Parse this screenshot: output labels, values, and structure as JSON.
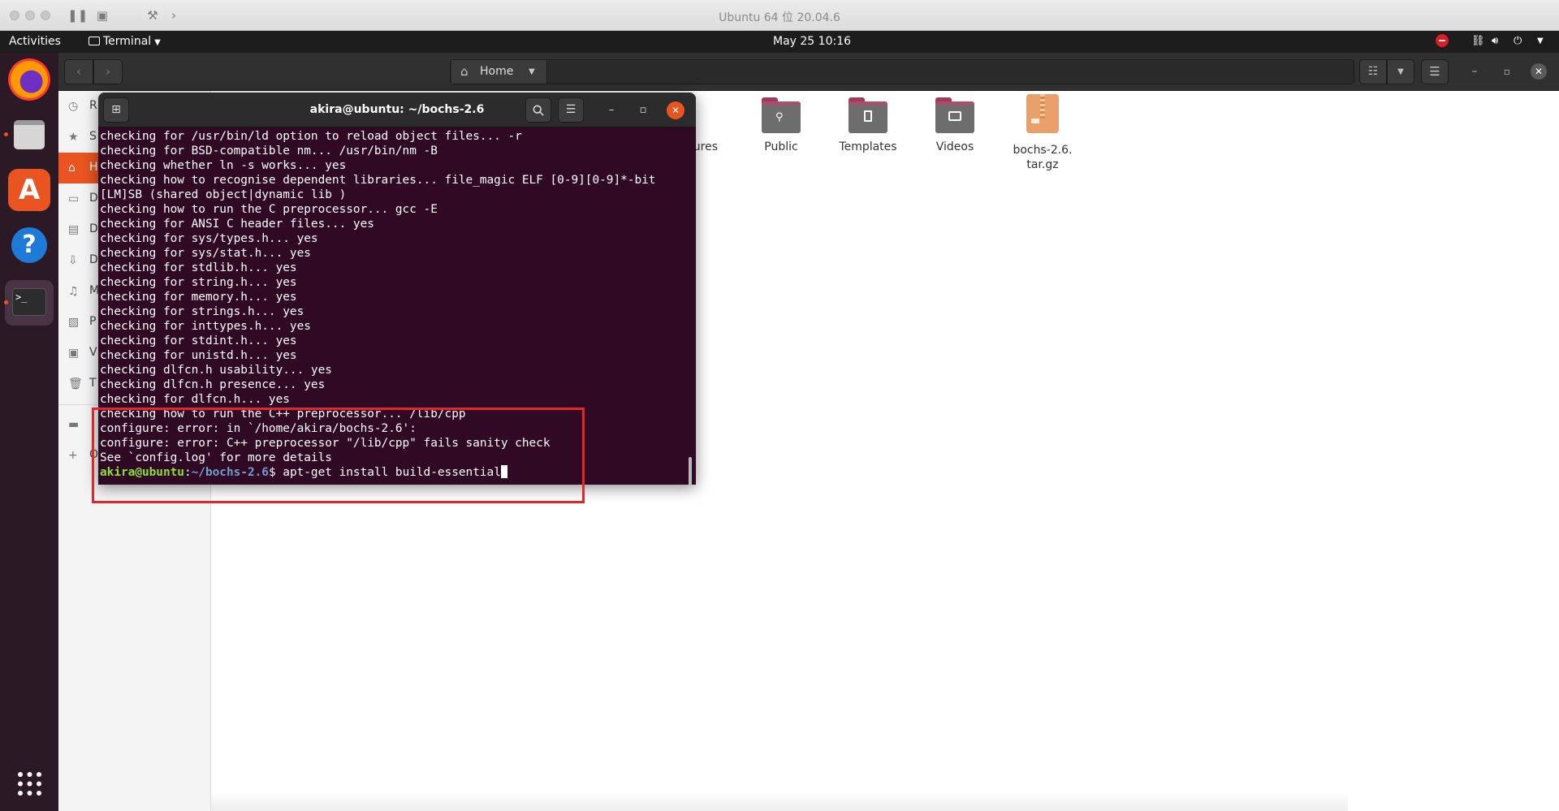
{
  "host": {
    "title": "Ubuntu 64 位 20.04.6"
  },
  "top_panel": {
    "activities": "Activities",
    "app_menu": "Terminal",
    "clock": "May 25  10:16"
  },
  "dock": {
    "apps": [
      {
        "name": "firefox",
        "icon": "firefox-icon"
      },
      {
        "name": "files",
        "icon": "files-icon"
      },
      {
        "name": "ubuntu-software",
        "icon": "software-icon"
      },
      {
        "name": "help",
        "icon": "help-icon"
      },
      {
        "name": "terminal",
        "icon": "terminal-icon"
      }
    ],
    "show_apps_icon": "grid-icon"
  },
  "files": {
    "location": "Home",
    "sidebar": [
      {
        "label": "R",
        "icon": "recent-icon"
      },
      {
        "label": "S",
        "icon": "star-icon"
      },
      {
        "label": "H",
        "icon": "home-icon"
      },
      {
        "label": "D",
        "icon": "desktop-icon"
      },
      {
        "label": "D",
        "icon": "document-icon"
      },
      {
        "label": "D",
        "icon": "download-icon"
      },
      {
        "label": "M",
        "icon": "music-icon"
      },
      {
        "label": "P",
        "icon": "picture-icon"
      },
      {
        "label": "V",
        "icon": "video-icon"
      },
      {
        "label": "T",
        "icon": "trash-icon"
      },
      {
        "label": "",
        "icon": "drive-icon"
      },
      {
        "label": "O",
        "icon": "plus-icon"
      }
    ],
    "items": [
      {
        "label": "ures"
      },
      {
        "label": "Public"
      },
      {
        "label": "Templates"
      },
      {
        "label": "Videos"
      },
      {
        "label": "bochs-2.6.\ntar.gz"
      }
    ]
  },
  "terminal": {
    "title": "akira@ubuntu: ~/bochs-2.6",
    "lines": [
      "checking for /usr/bin/ld option to reload object files... -r",
      "checking for BSD-compatible nm... /usr/bin/nm -B",
      "checking whether ln -s works... yes",
      "checking how to recognise dependent libraries... file_magic ELF [0-9][0-9]*-bit",
      "[LM]SB (shared object|dynamic lib )",
      "checking how to run the C preprocessor... gcc -E",
      "checking for ANSI C header files... yes",
      "checking for sys/types.h... yes",
      "checking for sys/stat.h... yes",
      "checking for stdlib.h... yes",
      "checking for string.h... yes",
      "checking for memory.h... yes",
      "checking for strings.h... yes",
      "checking for inttypes.h... yes",
      "checking for stdint.h... yes",
      "checking for unistd.h... yes",
      "checking dlfcn.h usability... yes",
      "checking dlfcn.h presence... yes",
      "checking for dlfcn.h... yes",
      "checking how to run the C++ preprocessor... /lib/cpp",
      "configure: error: in `/home/akira/bochs-2.6':",
      "configure: error: C++ preprocessor \"/lib/cpp\" fails sanity check",
      "See `config.log' for more details"
    ],
    "prompt_user": "akira@ubuntu",
    "prompt_sep": ":",
    "prompt_path": "~/bochs-2.6",
    "prompt_symbol": "$ ",
    "command": "apt-get install build-essential"
  },
  "colors": {
    "accent": "#e95420",
    "terminal_bg": "#300a24",
    "highlight": "#e0262b",
    "prompt_user": "#8ae234",
    "prompt_path": "#729fcf"
  }
}
